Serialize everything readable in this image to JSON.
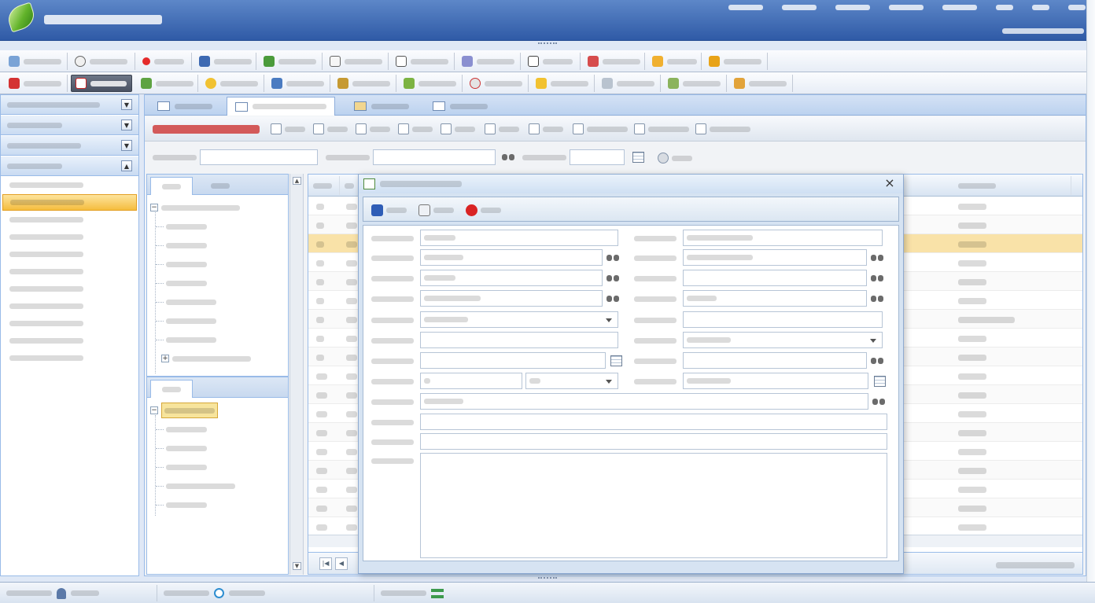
{
  "theme": {
    "header_top": "#5d87c8",
    "header_bottom": "#2f5aa6",
    "active_item": "#f5bd3e",
    "selected_row": "#f9e2a8",
    "title_red": "#d35a5a",
    "border": "#99bbe8"
  },
  "icons": {
    "logo": "leaf-logo",
    "dialog_close": "close-icon",
    "toggle": "chevron-down-icon",
    "search": "binoculars-icon",
    "date": "calendar-icon",
    "save": "floppy-disk-icon",
    "attach": "paperclip-icon",
    "cancel": "red-x-icon",
    "user": "user-icon",
    "time": "clock-icon",
    "org": "org-chart-icon"
  }
}
